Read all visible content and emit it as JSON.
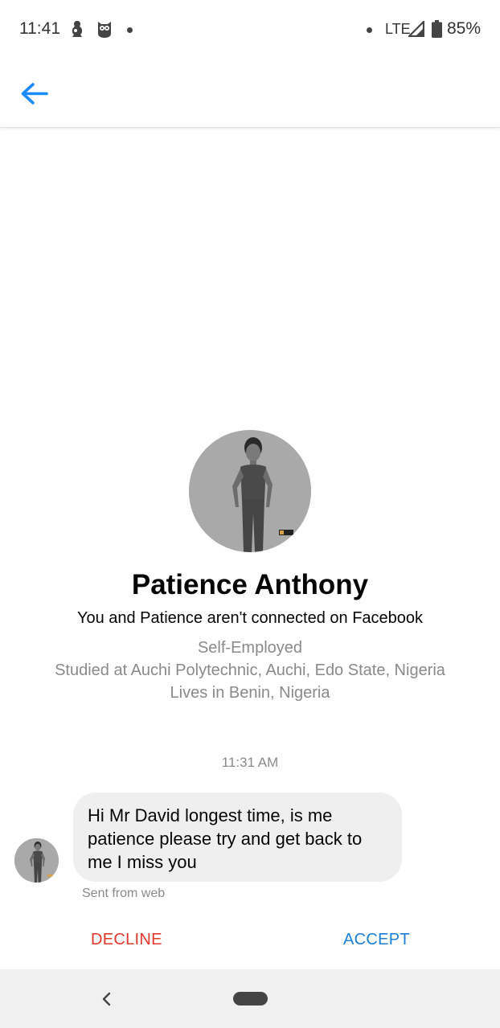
{
  "status_bar": {
    "time": "11:41",
    "network": "LTE",
    "battery": "85%",
    "icons": [
      "notification-app-icon",
      "owl-app-icon",
      "dot-icon",
      "dot-icon",
      "signal-icon",
      "battery-icon"
    ]
  },
  "app_bar": {
    "back_icon": "arrow-left-icon",
    "accent_color": "#1a8cff"
  },
  "profile": {
    "name": "Patience Anthony",
    "connection_note": "You and Patience aren't connected on Facebook",
    "work": "Self-Employed",
    "education": "Studied at Auchi Polytechnic, Auchi, Edo State, Nigeria",
    "location": "Lives in Benin, Nigeria"
  },
  "conversation": {
    "timestamp": "11:31 AM",
    "message_lines": [
      "Hi Mr David longest time, is me",
      "patience please try and get back to",
      "me I miss you"
    ],
    "sent_from": "Sent from web"
  },
  "actions": {
    "decline_label": "DECLINE",
    "accept_label": "ACCEPT",
    "decline_color": "#e0392b",
    "accept_color": "#1a7fd6"
  },
  "nav_bar": {
    "icons": [
      "chevron-left-icon",
      "home-pill-icon"
    ]
  }
}
